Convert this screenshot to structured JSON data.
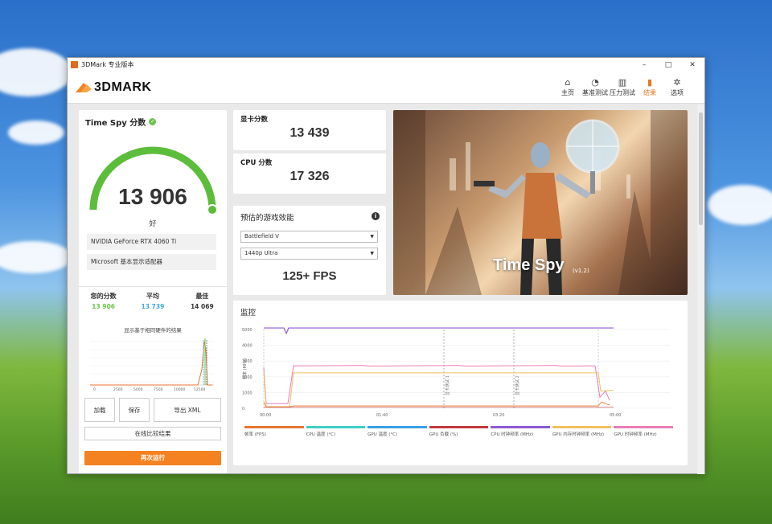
{
  "window": {
    "title": "3DMark 专业版本",
    "minimize": "–",
    "maximize": "□",
    "close": "✕"
  },
  "brand": {
    "logo_text": "3DMARK"
  },
  "nav": [
    {
      "label": "主页",
      "icon": "home-icon",
      "glyph": "⌂"
    },
    {
      "label": "基准测试",
      "icon": "gauge-icon",
      "glyph": "◔"
    },
    {
      "label": "压力测试",
      "icon": "bar-chart-icon",
      "glyph": "▥"
    },
    {
      "label": "结果",
      "icon": "results-icon",
      "glyph": "▮"
    },
    {
      "label": "选项",
      "icon": "gear-icon",
      "glyph": "✲"
    }
  ],
  "active_nav": "结果",
  "score_panel": {
    "title": "Time Spy 分数",
    "score": "13 906",
    "rating": "好",
    "gpu": "NVIDIA GeForce RTX 4060 Ti",
    "adapter": "Microsoft 基本显示适配器",
    "gauge_fraction": 1.0,
    "stats": [
      {
        "label": "您的分数",
        "value": "13 906",
        "color": "#6cc24a"
      },
      {
        "label": "平均",
        "value": "13 739",
        "color": "#3fa7e0"
      },
      {
        "label": "最佳",
        "value": "14 069",
        "color": "#333333"
      }
    ],
    "distribution_title": "显示基于相同硬件的结果",
    "distribution_ticks": [
      "0",
      "2500",
      "5000",
      "7500",
      "10000",
      "12500"
    ],
    "buttons": {
      "load": "加载",
      "save": "保存",
      "export": "导出 XML",
      "compare": "在线比较结果",
      "run_again": "再次运行"
    }
  },
  "gpu_score": {
    "label": "显卡分数",
    "value": "13 439"
  },
  "cpu_score": {
    "label": "CPU 分数",
    "value": "17 326"
  },
  "estimate": {
    "title": "预估的游戏效能",
    "game": "Battlefield V",
    "preset": "1440p Ultra",
    "fps": "125+ FPS"
  },
  "hero": {
    "title": "Time Spy",
    "version": "(v1.2)"
  },
  "monitor": {
    "title": "监控",
    "y_label": "频率 (MHz)",
    "y_ticks": [
      "5000",
      "4000",
      "3000",
      "2000",
      "1000",
      "0"
    ],
    "x_ticks": [
      "00:00",
      "01:40",
      "03:20",
      "05:00"
    ],
    "markers": [
      "显卡测试 1",
      "显卡测试 2"
    ],
    "legend": [
      {
        "label": "帧率 (FPS)",
        "color": "#e8762d"
      },
      {
        "label": "CPU 温度 (°C)",
        "color": "#3ecfc4"
      },
      {
        "label": "GPU 温度 (°C)",
        "color": "#3aa0e0"
      },
      {
        "label": "GPU 负载 (%)",
        "color": "#c0393b"
      },
      {
        "label": "CPU 时钟频率 (MHz)",
        "color": "#8e5bd1"
      },
      {
        "label": "GPU 内存时钟频率 (MHz)",
        "color": "#f0c060"
      },
      {
        "label": "GPU 时钟频率 (MHz)",
        "color": "#e97db7"
      }
    ]
  }
}
